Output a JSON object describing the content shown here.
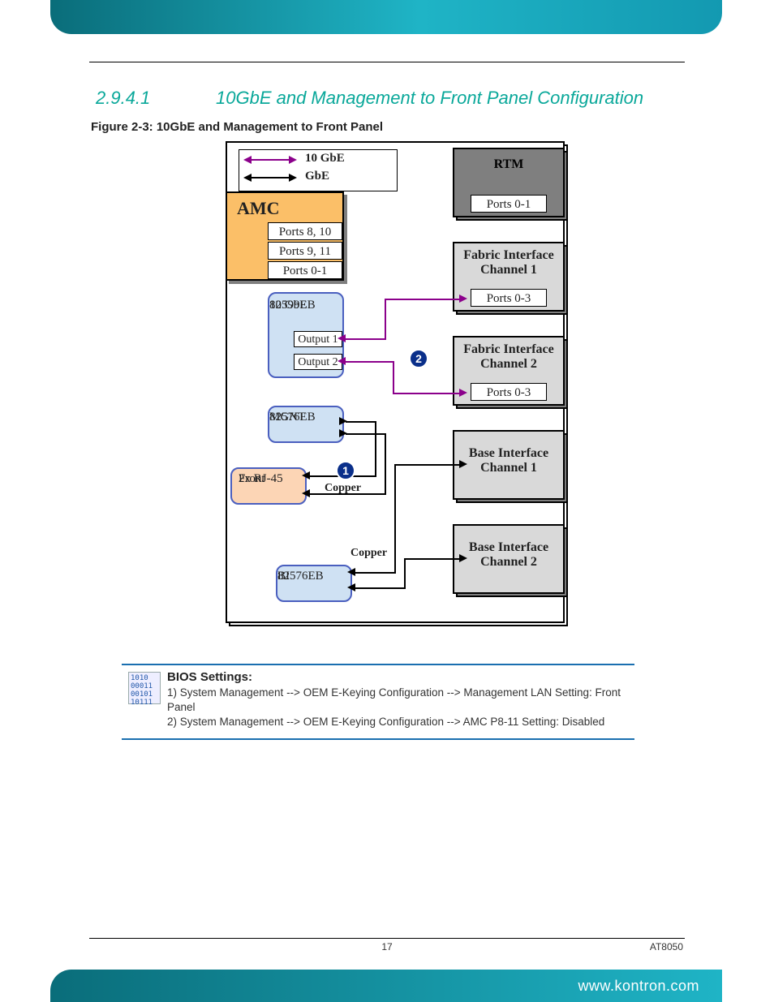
{
  "section": {
    "number": "2.9.4.1",
    "title": "10GbE and Management to Front Panel Configuration"
  },
  "figure_caption": "Figure 2-3: 10GbE and Management to Front Panel",
  "legend": {
    "ten_g": "10 GbE",
    "g": "GbE"
  },
  "amc": {
    "title": "AMC",
    "ports": [
      "Ports 8, 10",
      "Ports 9, 11",
      "Ports 0-1"
    ]
  },
  "right_modules": {
    "rtm": {
      "title": "RTM",
      "ports": "Ports 0-1"
    },
    "fic1": {
      "title": "Fabric Interface\nChannel 1",
      "ports": "Ports 0-3"
    },
    "fic2": {
      "title": "Fabric Interface\nChannel 2",
      "ports": "Ports 0-3"
    },
    "bic1": {
      "title": "Base Interface\nChannel 1"
    },
    "bic2": {
      "title": "Base Interface\nChannel 2"
    }
  },
  "chips": {
    "eb82599": {
      "line1": "82599EB",
      "line2": "10 GbE",
      "out1": "Output 1",
      "out2": "Output 2"
    },
    "mgnt": {
      "line1": "MGNT",
      "line2": "82576EB"
    },
    "front": {
      "line1": "Front",
      "line2": "2x RJ-45"
    },
    "bi": {
      "line1": "BI",
      "line2": "82576EB"
    }
  },
  "badges": {
    "one": "1",
    "two": "2"
  },
  "labels": {
    "copper1": "Copper",
    "copper2": "Copper"
  },
  "bios": {
    "heading": "BIOS Settings:",
    "line1": "1) System Management --> OEM E-Keying Configuration --> Management LAN Setting: Front Panel",
    "line2": "2) System Management --> OEM E-Keying Configuration --> AMC P8-11 Setting: Disabled",
    "icon_text": "1010\n00011\n00101\n10111"
  },
  "footer": {
    "page": "17",
    "model": "AT8050",
    "url": "www.kontron.com"
  }
}
